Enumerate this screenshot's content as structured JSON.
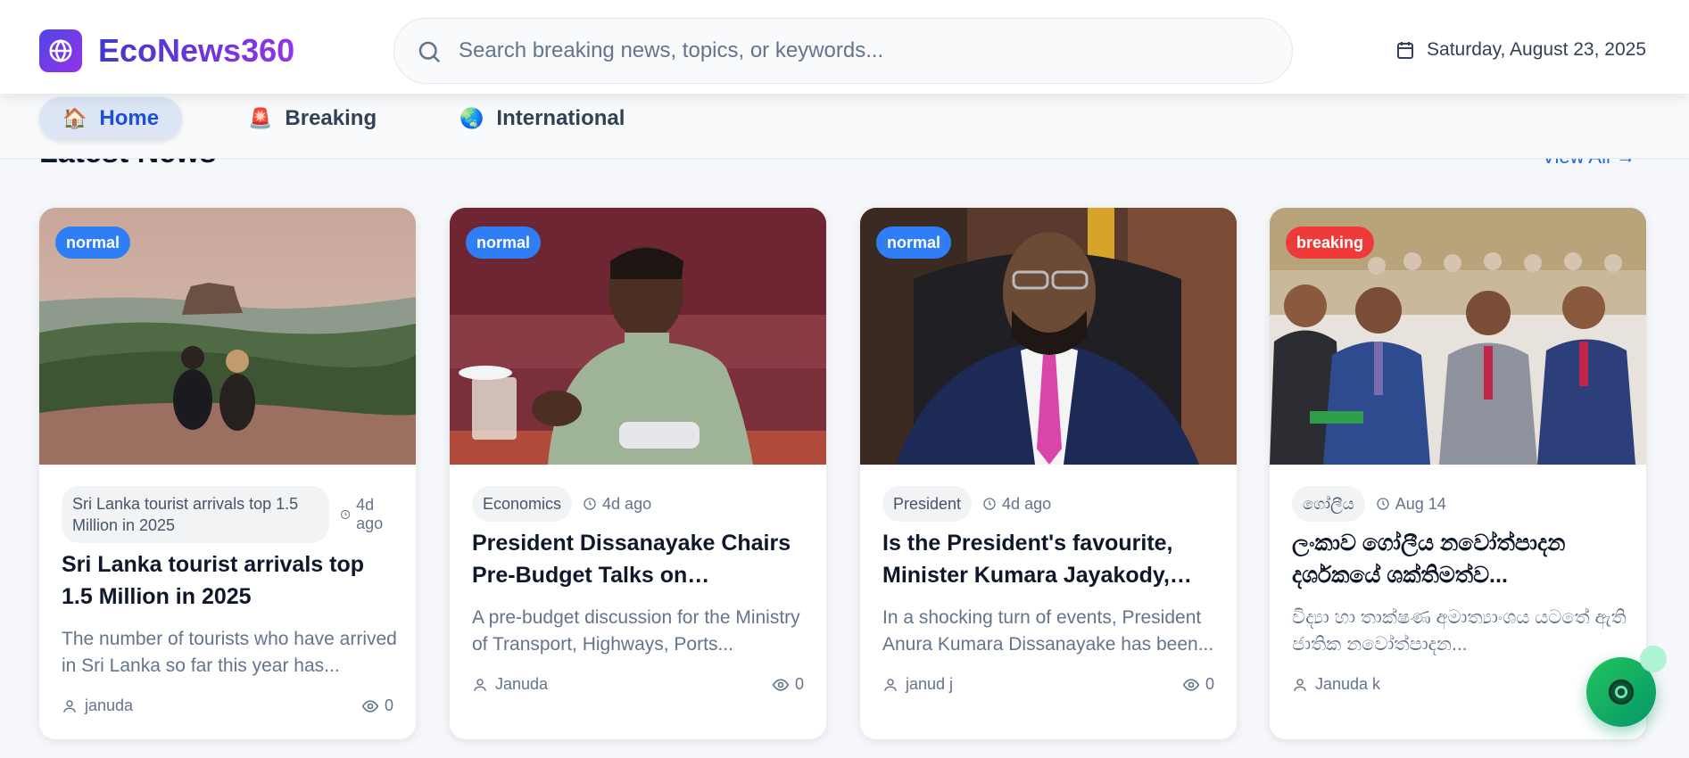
{
  "header": {
    "brand": "EcoNews360",
    "search_placeholder": "Search breaking news, topics, or keywords...",
    "date": "Saturday, August 23, 2025"
  },
  "nav": {
    "items": [
      {
        "emoji": "🏠",
        "label": "Home",
        "active": true
      },
      {
        "emoji": "🚨",
        "label": "Breaking",
        "active": false
      },
      {
        "emoji": "🌏",
        "label": "International",
        "active": false
      }
    ]
  },
  "section": {
    "title": "Latest News",
    "view_all": "View All →"
  },
  "articles": [
    {
      "badge": "normal",
      "category": "Sri Lanka tourist arrivals top 1.5 Million in 2025",
      "time": "4d ago",
      "title": "Sri Lanka tourist arrivals top 1.5 Million in 2025",
      "excerpt": "The number of tourists who have arrived in Sri Lanka so far this year has...",
      "author": "januda",
      "views": "0"
    },
    {
      "badge": "normal",
      "category": "Economics",
      "time": "4d ago",
      "title": "President Dissanayake Chairs Pre-Budget Talks on Transport,...",
      "excerpt": "A pre-budget discussion for the Ministry of Transport, Highways, Ports...",
      "author": "Januda",
      "views": "0"
    },
    {
      "badge": "normal",
      "category": "President",
      "time": "4d ago",
      "title": "Is the President's favourite, Minister Kumara Jayakody, goin...",
      "excerpt": "In a shocking turn of events, President Anura Kumara Dissanayake has been...",
      "author": "janud j",
      "views": "0"
    },
    {
      "badge": "breaking",
      "category": "ගෝලීය",
      "time": "Aug 14",
      "title": "ලංකාව ගෝලීය නවෝත්පාදන දර්ශකයේ ශක්තිමත්ව...",
      "excerpt": "විද්‍යා හා තාක්ෂණ අමාත්‍යාංශය යටතේ ඇති ජාතික නවෝත්පාදන...",
      "author": "Januda k",
      "views": ""
    }
  ],
  "colors": {
    "brand_gradient_start": "#4338ca",
    "brand_gradient_end": "#9333ea",
    "badge_normal": "#2f7ef6",
    "badge_breaking": "#ef3a3a",
    "nav_active_bg": "#dbe5f4",
    "fab": "#16a34a"
  }
}
